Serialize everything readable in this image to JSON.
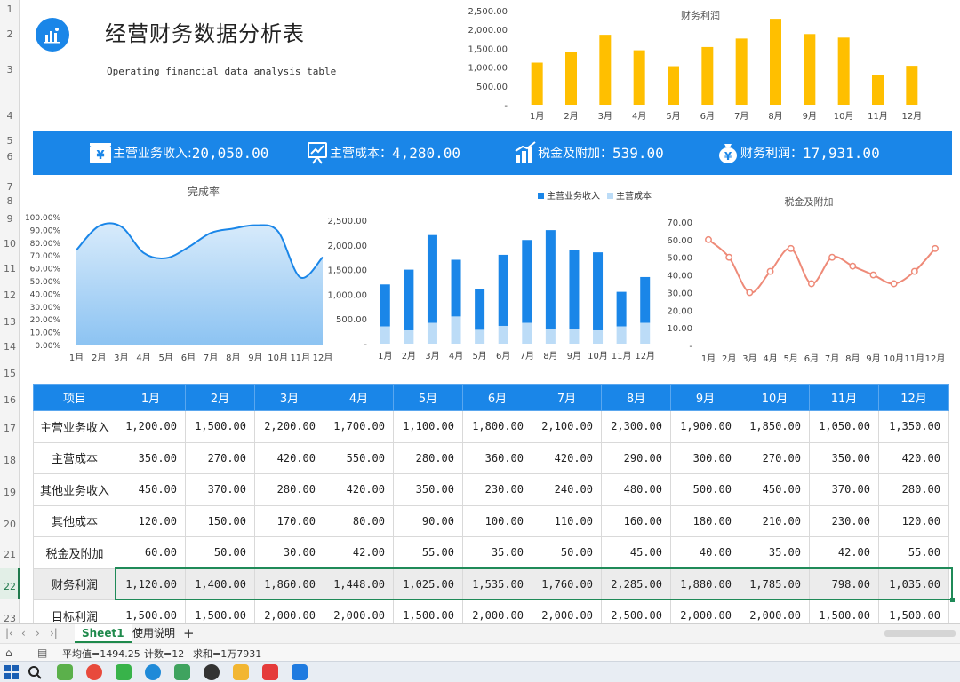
{
  "title": "经营财务数据分析表",
  "subtitle": "Operating financial data analysis table",
  "kpi": [
    {
      "label": "主营业务收入:",
      "value": "20,050.00",
      "icon": "yuan-card-icon"
    },
    {
      "label": "主营成本：",
      "value": "4,280.00",
      "icon": "chart-board-icon"
    },
    {
      "label": "税金及附加：",
      "value": "539.00",
      "icon": "bar-trend-icon"
    },
    {
      "label": "财务利润：",
      "value": "17,931.00",
      "icon": "money-bag-icon"
    }
  ],
  "row_numbers": [
    "1",
    "2",
    "3",
    "4",
    "5",
    "6",
    "7",
    "8",
    "9",
    "10",
    "11",
    "12",
    "13",
    "14",
    "15",
    "16",
    "17",
    "18",
    "19",
    "20",
    "21",
    "22",
    "23"
  ],
  "months": [
    "1月",
    "2月",
    "3月",
    "4月",
    "5月",
    "6月",
    "7月",
    "8月",
    "9月",
    "10月",
    "11月",
    "12月"
  ],
  "table": {
    "header_first": "项目",
    "rows": [
      {
        "name": "主营业务收入",
        "values": [
          "1,200.00",
          "1,500.00",
          "2,200.00",
          "1,700.00",
          "1,100.00",
          "1,800.00",
          "2,100.00",
          "2,300.00",
          "1,900.00",
          "1,850.00",
          "1,050.00",
          "1,350.00"
        ]
      },
      {
        "name": "主营成本",
        "values": [
          "350.00",
          "270.00",
          "420.00",
          "550.00",
          "280.00",
          "360.00",
          "420.00",
          "290.00",
          "300.00",
          "270.00",
          "350.00",
          "420.00"
        ]
      },
      {
        "name": "其他业务收入",
        "values": [
          "450.00",
          "370.00",
          "280.00",
          "420.00",
          "350.00",
          "230.00",
          "240.00",
          "480.00",
          "500.00",
          "450.00",
          "370.00",
          "280.00"
        ]
      },
      {
        "name": "其他成本",
        "values": [
          "120.00",
          "150.00",
          "170.00",
          "80.00",
          "90.00",
          "100.00",
          "110.00",
          "160.00",
          "180.00",
          "210.00",
          "230.00",
          "120.00"
        ]
      },
      {
        "name": "税金及附加",
        "values": [
          "60.00",
          "50.00",
          "30.00",
          "42.00",
          "55.00",
          "35.00",
          "50.00",
          "45.00",
          "40.00",
          "35.00",
          "42.00",
          "55.00"
        ]
      },
      {
        "name": "财务利润",
        "values": [
          "1,120.00",
          "1,400.00",
          "1,860.00",
          "1,448.00",
          "1,025.00",
          "1,535.00",
          "1,760.00",
          "2,285.00",
          "1,880.00",
          "1,785.00",
          "798.00",
          "1,035.00"
        ]
      },
      {
        "name": "目标利润",
        "values": [
          "1,500.00",
          "1,500.00",
          "2,000.00",
          "2,000.00",
          "1,500.00",
          "2,000.00",
          "2,000.00",
          "2,500.00",
          "2,000.00",
          "2,000.00",
          "1,500.00",
          "1,500.00"
        ]
      }
    ]
  },
  "sheet_tabs": [
    "Sheet1",
    "使用说明"
  ],
  "status": {
    "average": "平均值=1494.25",
    "count": "计数=12",
    "sum": "求和=1万7931"
  },
  "colors": {
    "brand_blue": "#1a86e8",
    "profit_bar": "#ffbf00",
    "cost_bar": "#bcdcf7",
    "tax_line": "#ee8a78",
    "selection_green": "#1f8a58"
  },
  "chart_data": [
    {
      "type": "bar",
      "title": "财务利润",
      "categories": [
        "1月",
        "2月",
        "3月",
        "4月",
        "5月",
        "6月",
        "7月",
        "8月",
        "9月",
        "10月",
        "11月",
        "12月"
      ],
      "values": [
        1120,
        1400,
        1860,
        1448,
        1025,
        1535,
        1760,
        2285,
        1880,
        1785,
        798,
        1035
      ],
      "yticks": [
        "-",
        "500.00",
        "1,000.00",
        "1,500.00",
        "2,000.00",
        "2,500.00"
      ],
      "ylim": [
        0,
        2500
      ]
    },
    {
      "type": "area",
      "title": "完成率",
      "categories": [
        "1月",
        "2月",
        "3月",
        "4月",
        "5月",
        "6月",
        "7月",
        "8月",
        "9月",
        "10月",
        "11月",
        "12月"
      ],
      "values": [
        74.7,
        93.3,
        93.0,
        72.4,
        68.3,
        76.8,
        88.0,
        91.4,
        94.0,
        89.3,
        53.2,
        69.0
      ],
      "yticks": [
        "0.00%",
        "10.00%",
        "20.00%",
        "30.00%",
        "40.00%",
        "50.00%",
        "60.00%",
        "70.00%",
        "80.00%",
        "90.00%",
        "100.00%"
      ],
      "ylim": [
        0,
        100
      ]
    },
    {
      "type": "bar",
      "stacked": true,
      "categories": [
        "1月",
        "2月",
        "3月",
        "4月",
        "5月",
        "6月",
        "7月",
        "8月",
        "9月",
        "10月",
        "11月",
        "12月"
      ],
      "series": [
        {
          "name": "主营业务收入",
          "values": [
            1200,
            1500,
            2200,
            1700,
            1100,
            1800,
            2100,
            2300,
            1900,
            1850,
            1050,
            1350
          ]
        },
        {
          "name": "主营成本",
          "values": [
            350,
            270,
            420,
            550,
            280,
            360,
            420,
            290,
            300,
            270,
            350,
            420
          ]
        }
      ],
      "yticks": [
        "-",
        "500.00",
        "1,000.00",
        "1,500.00",
        "2,000.00",
        "2,500.00"
      ],
      "ylim": [
        0,
        2500
      ],
      "legend": "top"
    },
    {
      "type": "line",
      "title": "税金及附加",
      "categories": [
        "1月",
        "2月",
        "3月",
        "4月",
        "5月",
        "6月",
        "7月",
        "8月",
        "9月",
        "10月",
        "11月",
        "12月"
      ],
      "values": [
        60,
        50,
        30,
        42,
        55,
        35,
        50,
        45,
        40,
        35,
        42,
        55
      ],
      "yticks": [
        "-",
        "10.00",
        "20.00",
        "30.00",
        "40.00",
        "50.00",
        "60.00",
        "70.00"
      ],
      "ylim": [
        0,
        70
      ]
    }
  ]
}
